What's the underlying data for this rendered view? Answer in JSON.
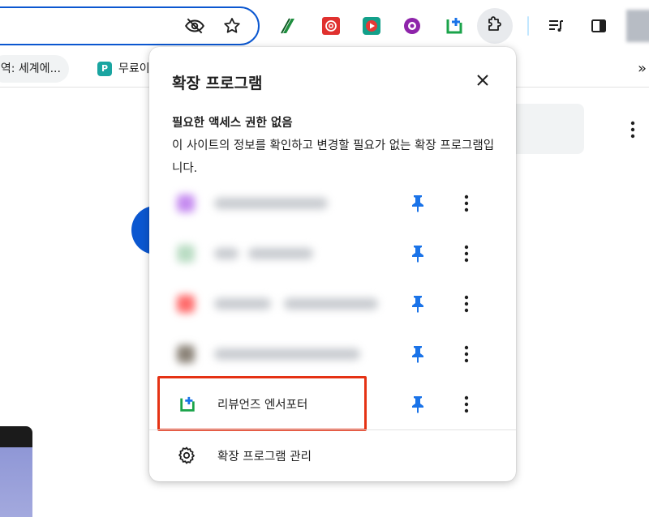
{
  "bookmarks": {
    "item1_label": "번역: 세계에...",
    "item2_label": "무료이",
    "more_label": "»"
  },
  "popup": {
    "title": "확장 프로그램",
    "section_title": "필요한 액세스 권한 없음",
    "section_desc": "이 사이트의 정보를 확인하고 변경할 필요가 없는 확장 프로그램입니다.",
    "visible_extension_label": "리뷰언즈 엔서포터",
    "manage_label": "확장 프로그램 관리"
  },
  "colors": {
    "accent_blue": "#0b57d0",
    "pin_blue": "#1a73e8",
    "highlight_red": "#e53214",
    "extension_green": "#1aa34a"
  },
  "icons": {
    "omnibox": [
      "eye-off-icon",
      "star-icon"
    ],
    "toolbar": [
      "pen-icon",
      "openai-icon",
      "play-icon",
      "purple-circle-icon",
      "green-plus-icon",
      "puzzle-icon",
      "music-list-icon",
      "side-panel-icon"
    ],
    "popup": [
      "close-icon",
      "pin-icon",
      "more-vert-icon",
      "settings-gear-icon"
    ]
  }
}
